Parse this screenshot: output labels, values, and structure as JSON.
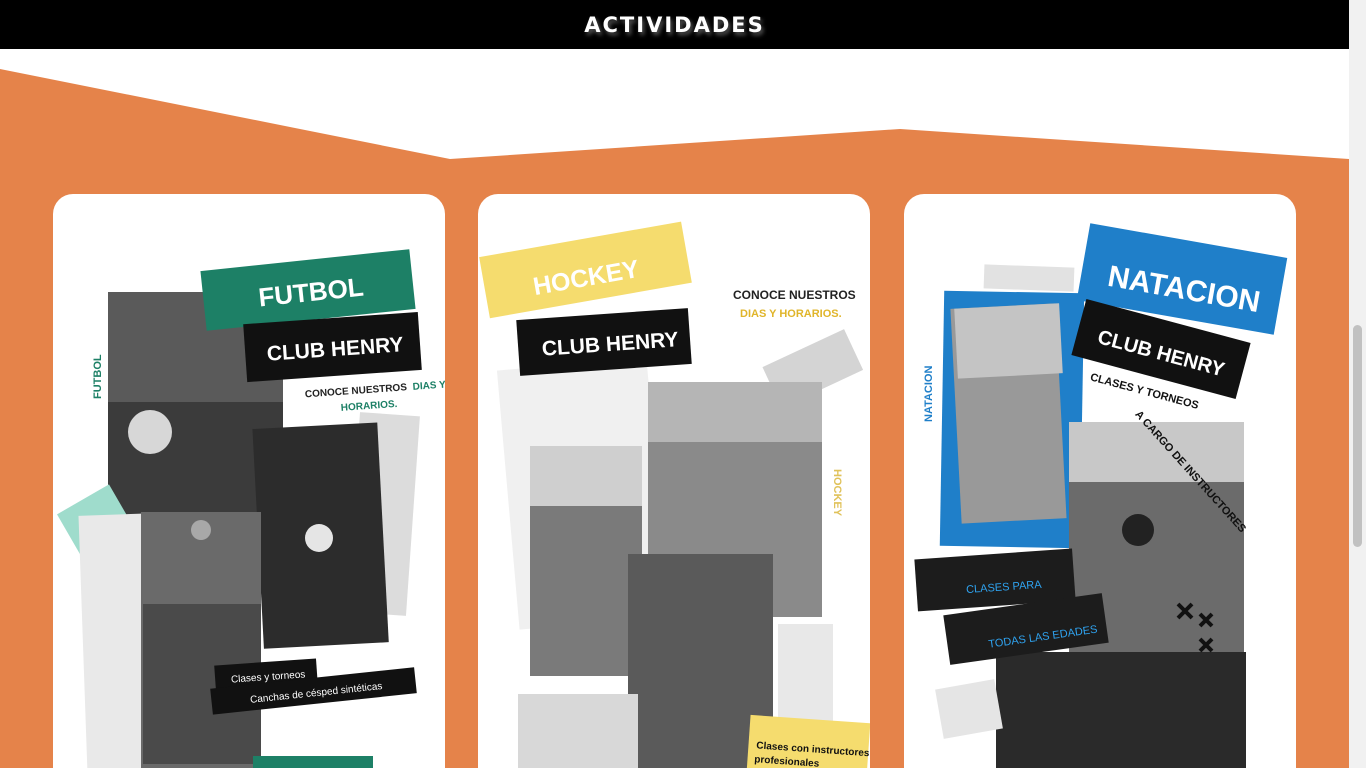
{
  "header": {
    "title": "ACTIVIDADES"
  },
  "colors": {
    "orange": "#e5834a",
    "futbol_green": "#1d8066",
    "hockey_yellow": "#f5dc6e",
    "natacion_blue": "#1f7fc9"
  },
  "cards": [
    {
      "sport": "FUTBOL",
      "club": "CLUB HENRY",
      "cta_line1": "CONOCE NUESTROS",
      "cta_accent1": "DIAS Y",
      "cta_line2": "HORARIOS.",
      "side_label": "FUTBOL",
      "note1": "Clases y torneos",
      "note2": "Canchas de césped  sintéticas"
    },
    {
      "sport": "HOCKEY",
      "club": "CLUB HENRY",
      "cta_line1": "CONOCE NUESTROS",
      "cta_line2": "DIAS Y HORARIOS.",
      "side_label": "HOCKEY",
      "note1": "Clases con instructores",
      "note2": "profesionales"
    },
    {
      "sport": "NATACION",
      "club": "CLUB HENRY",
      "handwritten1": "CLASES Y TORNEOS",
      "handwritten2": "A CARGO DE INSTRUCTORES",
      "side_label": "NATACION",
      "note1": "CLASES PARA",
      "note2": "TODAS LAS EDADES"
    }
  ]
}
